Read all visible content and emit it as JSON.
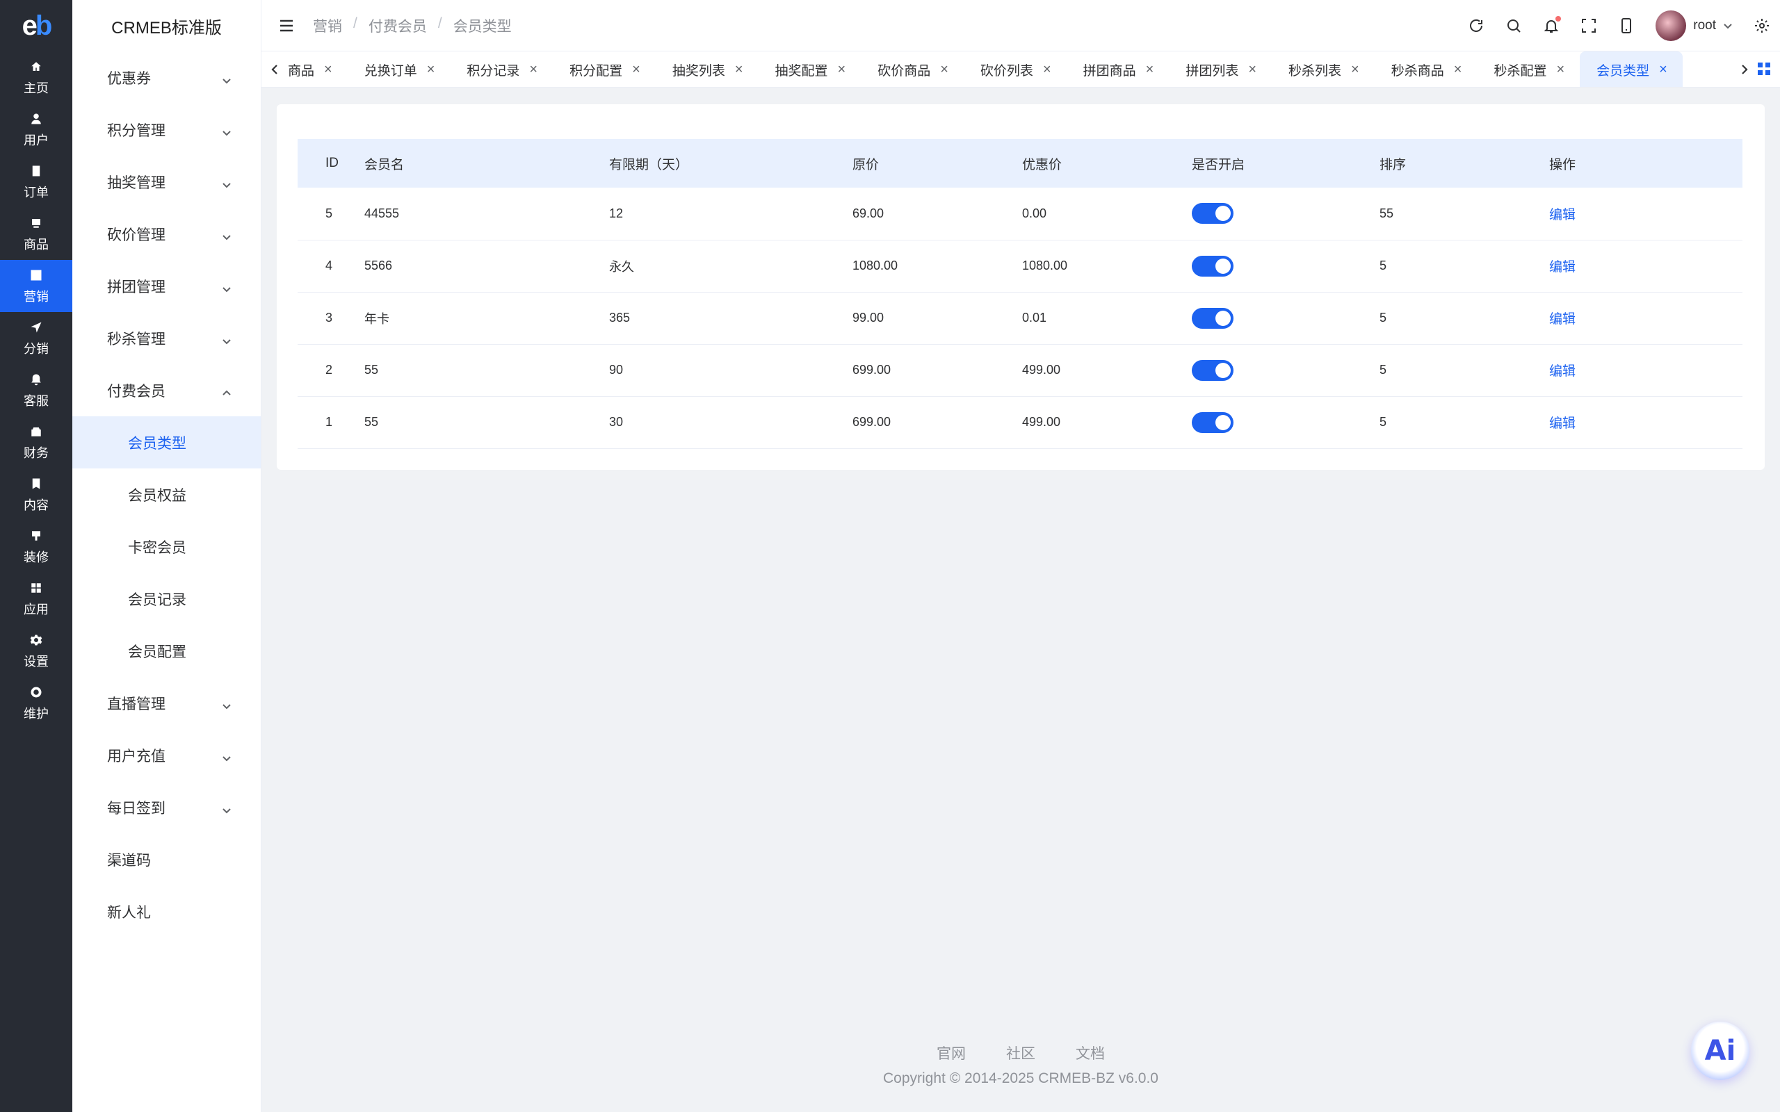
{
  "rail": {
    "items": [
      {
        "label": "主页",
        "icon": "home-icon"
      },
      {
        "label": "用户",
        "icon": "user-icon"
      },
      {
        "label": "订单",
        "icon": "order-icon"
      },
      {
        "label": "商品",
        "icon": "product-icon"
      },
      {
        "label": "营销",
        "icon": "marketing-icon"
      },
      {
        "label": "分销",
        "icon": "send-icon"
      },
      {
        "label": "客服",
        "icon": "bell-icon"
      },
      {
        "label": "财务",
        "icon": "finance-icon"
      },
      {
        "label": "内容",
        "icon": "content-icon"
      },
      {
        "label": "装修",
        "icon": "decorate-icon"
      },
      {
        "label": "应用",
        "icon": "apps-icon"
      },
      {
        "label": "设置",
        "icon": "gear-icon"
      },
      {
        "label": "维护",
        "icon": "maintenance-icon"
      }
    ]
  },
  "sidebar": {
    "title": "CRMEB标准版",
    "items": [
      {
        "label": "优惠券"
      },
      {
        "label": "积分管理"
      },
      {
        "label": "抽奖管理"
      },
      {
        "label": "砍价管理"
      },
      {
        "label": "拼团管理"
      },
      {
        "label": "秒杀管理"
      },
      {
        "label": "付费会员"
      }
    ],
    "sub_items": [
      {
        "label": "会员类型"
      },
      {
        "label": "会员权益"
      },
      {
        "label": "卡密会员"
      },
      {
        "label": "会员记录"
      },
      {
        "label": "会员配置"
      }
    ],
    "items_after": [
      {
        "label": "直播管理"
      },
      {
        "label": "用户充值"
      },
      {
        "label": "每日签到"
      },
      {
        "label": "渠道码"
      },
      {
        "label": "新人礼"
      }
    ]
  },
  "header": {
    "breadcrumb": [
      "营销",
      "付费会员",
      "会员类型"
    ],
    "username": "root"
  },
  "tabs": [
    {
      "label": "商品"
    },
    {
      "label": "兑换订单"
    },
    {
      "label": "积分记录"
    },
    {
      "label": "积分配置"
    },
    {
      "label": "抽奖列表"
    },
    {
      "label": "抽奖配置"
    },
    {
      "label": "砍价商品"
    },
    {
      "label": "砍价列表"
    },
    {
      "label": "拼团商品"
    },
    {
      "label": "拼团列表"
    },
    {
      "label": "秒杀列表"
    },
    {
      "label": "秒杀商品"
    },
    {
      "label": "秒杀配置"
    },
    {
      "label": "会员类型"
    }
  ],
  "table": {
    "columns": [
      "ID",
      "会员名",
      "有限期（天）",
      "原价",
      "优惠价",
      "是否开启",
      "排序",
      "操作"
    ],
    "rows": [
      {
        "id": "5",
        "name": "44555",
        "days": "12",
        "price": "69.00",
        "discount": "0.00",
        "sort": "55",
        "action": "编辑"
      },
      {
        "id": "4",
        "name": "5566",
        "days": "永久",
        "price": "1080.00",
        "discount": "1080.00",
        "sort": "5",
        "action": "编辑"
      },
      {
        "id": "3",
        "name": "年卡",
        "days": "365",
        "price": "99.00",
        "discount": "0.01",
        "sort": "5",
        "action": "编辑"
      },
      {
        "id": "2",
        "name": "55",
        "days": "90",
        "price": "699.00",
        "discount": "499.00",
        "sort": "5",
        "action": "编辑"
      },
      {
        "id": "1",
        "name": "55",
        "days": "30",
        "price": "699.00",
        "discount": "499.00",
        "sort": "5",
        "action": "编辑"
      }
    ]
  },
  "footer": {
    "links": [
      "官网",
      "社区",
      "文档"
    ],
    "copyright": "Copyright © 2014-2025 CRMEB-BZ v6.0.0"
  },
  "ai_button": {
    "label": "Ai"
  },
  "colors": {
    "primary": "#1c62f0",
    "rail_bg": "#282c34",
    "page_bg": "#f0f2f5"
  }
}
